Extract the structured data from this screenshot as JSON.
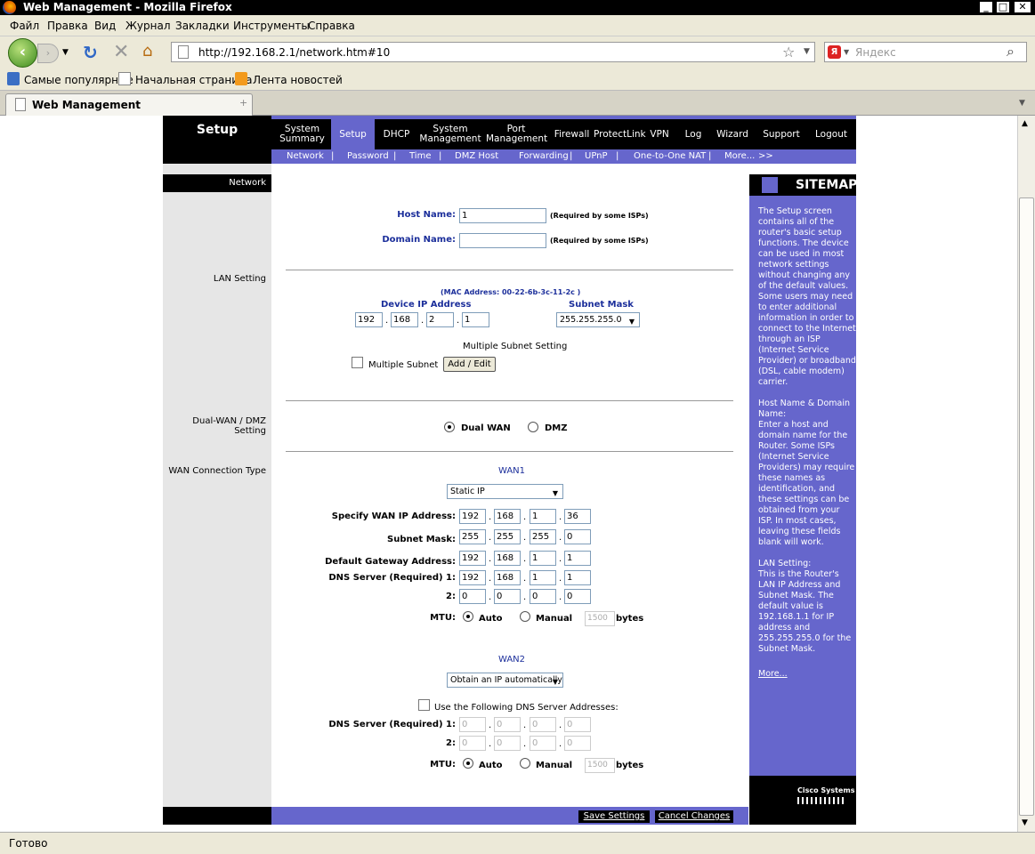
{
  "window": {
    "title": "Web Management - Mozilla Firefox"
  },
  "menu": [
    "Файл",
    "Правка",
    "Вид",
    "Журнал",
    "Закладки",
    "Инструменты",
    "Справка"
  ],
  "address": {
    "url": "http://192.168.2.1/network.htm#10"
  },
  "search": {
    "placeholder": "Яндекс",
    "engine_icon": "Я"
  },
  "bookmarks": [
    "Самые популярные",
    "Начальная страница",
    "Лента новостей"
  ],
  "tab": {
    "title": "Web Management"
  },
  "status": "Готово",
  "router": {
    "section_title": "Setup",
    "nav": [
      {
        "l1": "System",
        "l2": "Summary"
      },
      {
        "l1": "Setup",
        "l2": ""
      },
      {
        "l1": "DHCP",
        "l2": ""
      },
      {
        "l1": "System",
        "l2": "Management"
      },
      {
        "l1": "Port",
        "l2": "Management"
      },
      {
        "l1": "Firewall",
        "l2": ""
      },
      {
        "l1": "ProtectLink",
        "l2": ""
      },
      {
        "l1": "VPN",
        "l2": ""
      },
      {
        "l1": "Log",
        "l2": ""
      },
      {
        "l1": "Wizard",
        "l2": ""
      },
      {
        "l1": "Support",
        "l2": ""
      },
      {
        "l1": "Logout",
        "l2": ""
      }
    ],
    "subnav": [
      "Network",
      "Password",
      "Time",
      "DMZ Host",
      "Forwarding",
      "UPnP",
      "One-to-One NAT",
      "More...",
      ">>"
    ],
    "sections": {
      "network": "Network",
      "lan": "LAN Setting",
      "dualwan": "Dual-WAN / DMZ Setting",
      "wantype": "WAN Connection Type"
    },
    "host": {
      "label": "Host Name:",
      "value": "1",
      "note": "(Required by some ISPs)"
    },
    "domain": {
      "label": "Domain Name:",
      "value": "",
      "note": "(Required by some ISPs)"
    },
    "lan": {
      "mac": "(MAC Address: 00-22-6b-3c-11-2c )",
      "device_ip_label": "Device IP Address",
      "device_ip": [
        "192",
        "168",
        "2",
        "1"
      ],
      "subnet_label": "Subnet Mask",
      "subnet": "255.255.255.0",
      "multi_title": "Multiple Subnet Setting",
      "multi_label": "Multiple Subnet",
      "add_edit": "Add / Edit"
    },
    "dualwan": {
      "opt1": "Dual WAN",
      "opt2": "DMZ"
    },
    "wan1": {
      "title": "WAN1",
      "type": "Static IP",
      "ip_label": "Specify WAN IP Address:",
      "ip": [
        "192",
        "168",
        "1",
        "36"
      ],
      "mask_label": "Subnet Mask:",
      "mask": [
        "255",
        "255",
        "255",
        "0"
      ],
      "gw_label": "Default Gateway Address:",
      "gw": [
        "192",
        "168",
        "1",
        "1"
      ],
      "dns1_label": "DNS Server (Required) 1:",
      "dns1": [
        "192",
        "168",
        "1",
        "1"
      ],
      "dns2_label": "2:",
      "dns2": [
        "0",
        "0",
        "0",
        "0"
      ],
      "mtu_label": "MTU:",
      "auto": "Auto",
      "manual": "Manual",
      "mtu_value": "1500",
      "bytes": "bytes"
    },
    "wan2": {
      "title": "WAN2",
      "type": "Obtain an IP automatically",
      "use_dns": "Use the Following DNS Server Addresses:",
      "dns1_label": "DNS Server (Required) 1:",
      "dns1": [
        "0",
        "0",
        "0",
        "0"
      ],
      "dns2_label": "2:",
      "dns2": [
        "0",
        "0",
        "0",
        "0"
      ],
      "mtu_label": "MTU:",
      "auto": "Auto",
      "manual": "Manual",
      "mtu_value": "1500",
      "bytes": "bytes"
    },
    "sitemap": {
      "title": "SITEMAP",
      "text": "The Setup screen contains all of the router's basic setup functions. The device can be used in most network settings without changing any of the default values. Some users may need to enter additional information in order to connect to the Internet through an ISP (Internet Service Provider) or broadband (DSL, cable modem) carrier.\n\nHost Name & Domain Name:\nEnter a host and domain name for the Router. Some ISPs (Internet Service Providers) may require these names as identification, and these settings can be obtained from your ISP. In most cases, leaving these fields blank will work.\n\nLAN Setting:\nThis is the Router's LAN IP Address and Subnet Mask. The default value is 192.168.1.1 for IP address and 255.255.255.0 for the Subnet Mask.",
      "more": "More..."
    },
    "brand": "Cisco Systems",
    "save": "Save Settings",
    "cancel": "Cancel Changes"
  }
}
